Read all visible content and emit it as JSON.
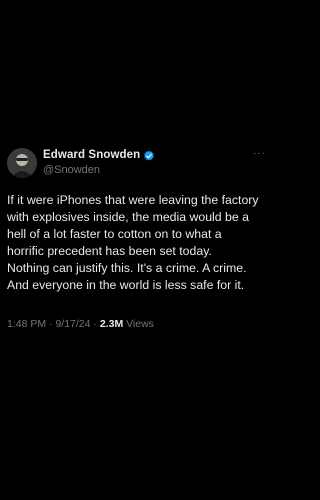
{
  "tweet": {
    "author_name": "Edward Snowden",
    "author_handle": "@Snowden",
    "more_label": "···",
    "body": "If it were iPhones that were leaving the factory\nwith explosives inside, the media would be a\nhell of a lot faster to cotton on to what a\nhorrific precedent has been set today.\nNothing can justify this. It's a crime. A crime.\nAnd everyone in the world is less safe for it.",
    "time": "1:48 PM",
    "separator": "·",
    "date": "9/17/24",
    "views_count": "2.3M",
    "views_label": "Views",
    "verified_color": "#1d9bf0"
  }
}
